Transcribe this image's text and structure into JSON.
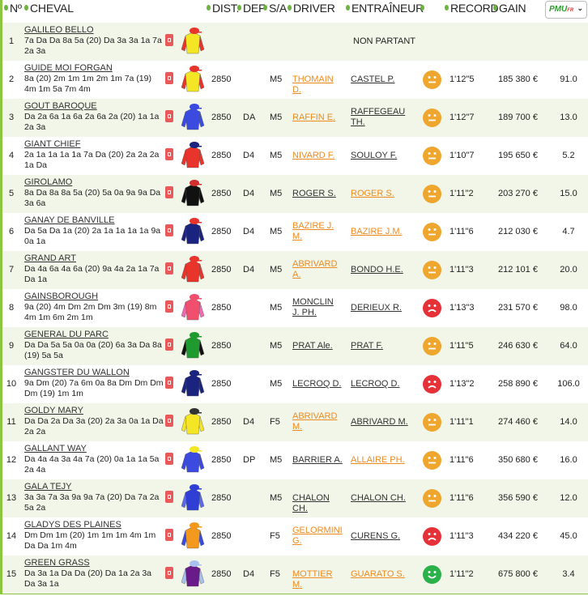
{
  "header": {
    "num": "Nº",
    "cheval": "CHEVAL",
    "dist": "DIST.",
    "def": "DEF",
    "sa": "S/A",
    "driver": "DRIVER",
    "entraineur": "ENTRAÎNEUR",
    "record": "RECORD",
    "gain": "GAIN",
    "provider": "PMU",
    "provider_suffix": "FR"
  },
  "colors": {
    "accent": "#8cc63f",
    "odd_row": "#f2f6e8",
    "link_orange": "#ef8a1e",
    "mood_neutral": "#efa62f",
    "mood_bad": "#e53138",
    "mood_good": "#2bb14a"
  },
  "rows": [
    {
      "num": "1",
      "name": "GALILEO BELLO",
      "form": "7a Da Da 8a 5a (20) Da 3a 3a 1a 7a 2a 3a",
      "dist": "",
      "def": "",
      "sa": "",
      "driver": "",
      "driver_color": "dark",
      "trainer": "",
      "trainer_color": "dark",
      "mood": "",
      "record": "",
      "gain": "",
      "odds": "",
      "status": "NON PARTANT",
      "silk": [
        "#f5e625",
        "#e8342a",
        "#e8342a"
      ]
    },
    {
      "num": "2",
      "name": "GUIDE MOI FORGAN",
      "form": "8a (20) 2m 1m 1m 2m 1m 7a (19) 4m 1m 5a 7m 4m",
      "dist": "2850",
      "def": "",
      "sa": "M5",
      "driver": "THOMAIN D.",
      "driver_color": "orange",
      "trainer": "CASTEL P.",
      "trainer_color": "dark",
      "mood": "neutral",
      "record": "1'12\"5",
      "gain": "185 380 €",
      "odds": "91.0",
      "silk": [
        "#f5e625",
        "#e8342a",
        "#e8342a"
      ]
    },
    {
      "num": "3",
      "name": "GOUT BAROQUE",
      "form": "Da 2a 6a 1a 6a 2a 6a 2a (20) 1a 1a 2a 3a",
      "dist": "2850",
      "def": "DA",
      "sa": "M5",
      "driver": "RAFFIN E.",
      "driver_color": "orange",
      "trainer": "RAFFEGEAU TH.",
      "trainer_color": "dark",
      "mood": "neutral",
      "record": "1'12\"7",
      "gain": "189 700 €",
      "odds": "13.0",
      "silk": [
        "#3b4be0",
        "#3b4be0",
        "#3b4be0"
      ]
    },
    {
      "num": "4",
      "name": "GIANT CHIEF",
      "form": "2a 1a 1a 1a 1a 7a Da (20) 2a 2a 2a 1a Da",
      "dist": "2850",
      "def": "D4",
      "sa": "M5",
      "driver": "NIVARD F.",
      "driver_color": "orange",
      "trainer": "SOULOY F.",
      "trainer_color": "dark",
      "mood": "neutral",
      "record": "1'10\"7",
      "gain": "195 650 €",
      "odds": "5.2",
      "silk": [
        "#e8342a",
        "#e8342a",
        "#1a237e"
      ]
    },
    {
      "num": "5",
      "name": "GIROLAMO",
      "form": "8a Da 8a 8a 5a (20) 5a 0a 9a 9a Da 3a 6a",
      "dist": "2850",
      "def": "D4",
      "sa": "M5",
      "driver": "ROGER S.",
      "driver_color": "dark",
      "trainer": "ROGER S.",
      "trainer_color": "orange",
      "mood": "neutral",
      "record": "1'11\"2",
      "gain": "203 270 €",
      "odds": "15.0",
      "silk": [
        "#111111",
        "#111111",
        "#d32f2f"
      ]
    },
    {
      "num": "6",
      "name": "GANAY DE BANVILLE",
      "form": "Da 5a Da 1a (20) 2a 1a 1a 1a 1a 9a 0a 1a",
      "dist": "2850",
      "def": "D4",
      "sa": "M5",
      "driver": "BAZIRE J. M.",
      "driver_color": "orange",
      "trainer": "BAZIRE J.M.",
      "trainer_color": "orange",
      "mood": "neutral",
      "record": "1'11\"6",
      "gain": "212 030 €",
      "odds": "4.7",
      "silk": [
        "#1a237e",
        "#1a237e",
        "#e8342a"
      ]
    },
    {
      "num": "7",
      "name": "GRAND ART",
      "form": "Da 4a 6a 4a 6a (20) 9a 4a 2a 1a 7a Da 1a",
      "dist": "2850",
      "def": "D4",
      "sa": "M5",
      "driver": "ABRIVARD A.",
      "driver_color": "orange",
      "trainer": "BONDO H.E.",
      "trainer_color": "dark",
      "mood": "neutral",
      "record": "1'11\"3",
      "gain": "212 101 €",
      "odds": "20.0",
      "silk": [
        "#e8342a",
        "#e8342a",
        "#e8342a"
      ]
    },
    {
      "num": "8",
      "name": "GAINSBOROUGH",
      "form": "9a (20) 4m Dm 2m Dm 3m (19) 8m 4m 1m 6m 2m 1m",
      "dist": "2850",
      "def": "",
      "sa": "M5",
      "driver": "MONCLIN J. PH.",
      "driver_color": "dark",
      "trainer": "DERIEUX R.",
      "trainer_color": "dark",
      "mood": "bad",
      "record": "1'13\"3",
      "gain": "231 570 €",
      "odds": "98.0",
      "silk": [
        "#f0506e",
        "#f06ab0",
        "#f0506e"
      ]
    },
    {
      "num": "9",
      "name": "GENERAL DU PARC",
      "form": "Da Da 5a 5a 0a 0a (20) 6a 3a Da 8a (19) 5a 5a",
      "dist": "2850",
      "def": "",
      "sa": "M5",
      "driver": "PRAT Ale.",
      "driver_color": "dark",
      "trainer": "PRAT F.",
      "trainer_color": "dark",
      "mood": "neutral",
      "record": "1'11\"5",
      "gain": "246 630 €",
      "odds": "64.0",
      "silk": [
        "#1f9a2e",
        "#111111",
        "#1f9a2e"
      ]
    },
    {
      "num": "10",
      "name": "GANGSTER DU WALLON",
      "form": "9a Dm (20) 7a 6m 0a 8a Dm Dm Dm Dm (19) 1m 1m",
      "dist": "2850",
      "def": "",
      "sa": "M5",
      "driver": "LECROQ D.",
      "driver_color": "dark",
      "trainer": "LECROQ D.",
      "trainer_color": "dark",
      "mood": "bad",
      "record": "1'13\"2",
      "gain": "258 890 €",
      "odds": "106.0",
      "silk": [
        "#1a237e",
        "#1a237e",
        "#1a237e"
      ]
    },
    {
      "num": "11",
      "name": "GOLDY MARY",
      "form": "Da Da 2a Da 3a (20) 2a 3a 0a 1a Da 2a 2a",
      "dist": "2850",
      "def": "D4",
      "sa": "F5",
      "driver": "ABRIVARD M.",
      "driver_color": "orange",
      "trainer": "ABRIVARD M.",
      "trainer_color": "dark",
      "mood": "neutral",
      "record": "1'11\"1",
      "gain": "274 460 €",
      "odds": "14.0",
      "silk": [
        "#f5e625",
        "#f5e625",
        "#333333"
      ]
    },
    {
      "num": "12",
      "name": "GALLANT WAY",
      "form": "Da 4a 4a 3a 4a 7a (20) 0a 1a 1a 5a 2a 4a",
      "dist": "2850",
      "def": "DP",
      "sa": "M5",
      "driver": "BARRIER A.",
      "driver_color": "dark",
      "trainer": "ALLAIRE PH.",
      "trainer_color": "orange",
      "mood": "neutral",
      "record": "1'11\"6",
      "gain": "350 680 €",
      "odds": "16.0",
      "silk": [
        "#3b4be0",
        "#3b4be0",
        "#f5e625"
      ]
    },
    {
      "num": "13",
      "name": "GALA TEJY",
      "form": "3a 3a 7a 3a 9a 9a 7a (20) Da 7a 2a 5a 2a",
      "dist": "2850",
      "def": "",
      "sa": "M5",
      "driver": "CHALON CH.",
      "driver_color": "dark",
      "trainer": "CHALON CH.",
      "trainer_color": "dark",
      "mood": "neutral",
      "record": "1'11\"6",
      "gain": "356 590 €",
      "odds": "12.0",
      "silk": [
        "#2f3fd6",
        "#5a6ae8",
        "#2f3fd6"
      ]
    },
    {
      "num": "14",
      "name": "GLADYS DES PLAINES",
      "form": "Dm Dm 1m (20) 1m 1m 1m 4m 1m Da Da 1m 4m",
      "dist": "2850",
      "def": "",
      "sa": "F5",
      "driver": "GELORMINI G.",
      "driver_color": "orange",
      "trainer": "CURENS G.",
      "trainer_color": "dark",
      "mood": "bad",
      "record": "1'11\"3",
      "gain": "434 220 €",
      "odds": "45.0",
      "silk": [
        "#f39a1e",
        "#3b4be0",
        "#f39a1e"
      ]
    },
    {
      "num": "15",
      "name": "GREEN GRASS",
      "form": "Da 3a 1a Da Da (20) Da 1a 2a 3a Da 3a 1a",
      "dist": "2850",
      "def": "D4",
      "sa": "F5",
      "driver": "MOTTIER M.",
      "driver_color": "orange",
      "trainer": "GUARATO S.",
      "trainer_color": "orange",
      "mood": "good",
      "record": "1'11\"2",
      "gain": "675 800 €",
      "odds": "3.4",
      "silk": [
        "#6a1b8a",
        "#a9c1ee",
        "#a9c1ee"
      ]
    }
  ]
}
